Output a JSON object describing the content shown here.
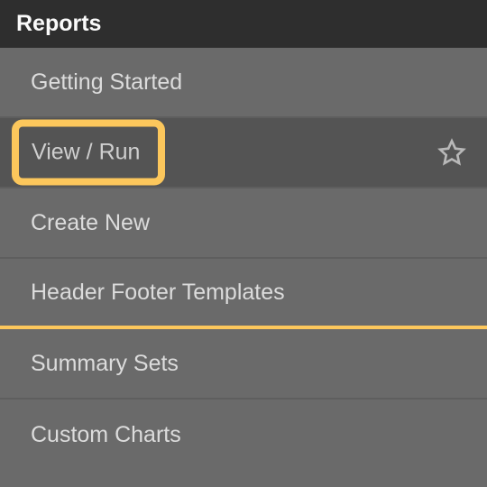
{
  "header": {
    "title": "Reports"
  },
  "menu": {
    "items": [
      {
        "label": "Getting Started"
      },
      {
        "label": "View / Run"
      },
      {
        "label": "Create New"
      },
      {
        "label": "Header Footer Templates"
      },
      {
        "label": "Summary Sets"
      },
      {
        "label": "Custom Charts"
      }
    ]
  }
}
